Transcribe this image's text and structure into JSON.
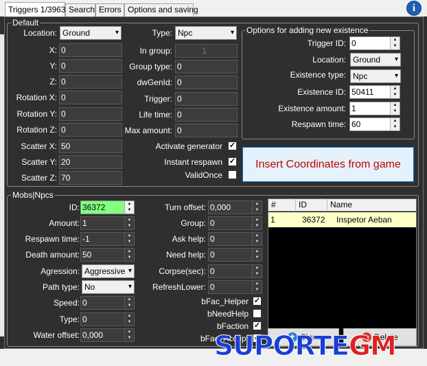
{
  "tabs": [
    "Triggers 1/3963",
    "Search",
    "Errors",
    "Options and saving"
  ],
  "info_icon": "info-icon",
  "default_group": {
    "title": "Default",
    "location_label": "Location:",
    "location_value": "Ground",
    "x_label": "X:",
    "x_value": "0",
    "y_label": "Y:",
    "y_value": "0",
    "z_label": "Z:",
    "z_value": "0",
    "rotx_label": "Rotation X:",
    "rotx_value": "0",
    "roty_label": "Rotation Y:",
    "roty_value": "0",
    "rotz_label": "Rotation Z:",
    "rotz_value": "0",
    "scx_label": "Scatter X:",
    "scx_value": "50",
    "scy_label": "Scatter Y:",
    "scy_value": "20",
    "scz_label": "Scatter Z:",
    "scz_value": "70",
    "type_label": "Type:",
    "type_value": "Npc",
    "ingroup_label": "In group:",
    "ingroup_value": "1",
    "grouptype_label": "Group type:",
    "grouptype_value": "0",
    "dwgen_label": "dwGenId:",
    "dwgen_value": "0",
    "trigger_label": "Trigger:",
    "trigger_value": "0",
    "lifetime_label": "Life time:",
    "lifetime_value": "0",
    "maxamount_label": "Max amount:",
    "maxamount_value": "0",
    "activate_label": "Activate generator",
    "activate_checked": "✓",
    "instant_label": "Instant respawn",
    "instant_checked": "✓",
    "validonce_label": "ValidOnce",
    "validonce_checked": ""
  },
  "options_group": {
    "title": "Options for adding new existence",
    "trigid_label": "Trigger ID:",
    "trigid_value": "0",
    "location_label": "Location:",
    "location_value": "Ground",
    "exttype_label": "Existence type:",
    "exttype_value": "Npc",
    "extid_label": "Existence ID:",
    "extid_value": "50411",
    "extamount_label": "Existence amount:",
    "extamount_value": "1",
    "respawn_label": "Respawn time:",
    "respawn_value": "60",
    "insert_button": "Insert Coordinates from game"
  },
  "mobs_group": {
    "title": "Mobs|Npcs",
    "id_label": "ID:",
    "id_value": "36372",
    "amount_label": "Amount:",
    "amount_value": "1",
    "respawn_label": "Respawn time:",
    "respawn_value": "-1",
    "death_label": "Death amount:",
    "death_value": "50",
    "agression_label": "Agression:",
    "agression_value": "Aggressive",
    "pathtype_label": "Path type:",
    "pathtype_value": "No",
    "speed_label": "Speed:",
    "speed_value": "0",
    "type_label": "Type:",
    "type_value": "0",
    "water_label": "Water offset:",
    "water_value": "0,000",
    "turn_label": "Turn offset:",
    "turn_value": "0,000",
    "group_label": "Group:",
    "group_value": "0",
    "askhelp_label": "Ask help:",
    "askhelp_value": "0",
    "needhelp_label": "Need help:",
    "needhelp_value": "0",
    "corpse_label": "Corpse(sec):",
    "corpse_value": "0",
    "refresh_label": "RefreshLower:",
    "refresh_value": "0",
    "bfachelper_label": "bFac_Helper",
    "bfachelper_checked": "✓",
    "bneedhelp_label": "bNeedHelp",
    "bneedhelp_checked": "",
    "bfaction_label": "bFaction",
    "bfaction_checked": "✓",
    "bfacaccept_label": "bFac_Accept",
    "bfacaccept_checked": "✓"
  },
  "grid": {
    "columns": [
      "#",
      "ID",
      "Name"
    ],
    "rows": [
      {
        "num": "1",
        "id": "36372",
        "name": "Inspetor Aeban"
      }
    ]
  },
  "buttons": {
    "clone": "Clone",
    "delete": "Delete"
  },
  "watermark": {
    "part1": "SUPORTE",
    "part2": "GM"
  },
  "colors": {
    "id_highlight": "#80ff80",
    "selected_row": "#ffffc8",
    "insert_text": "#c00000",
    "watermark_blue": "#1a3fd6",
    "watermark_red": "#e02020"
  }
}
